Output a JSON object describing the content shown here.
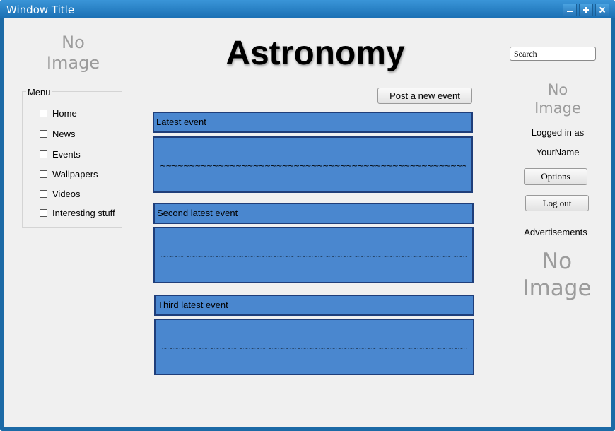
{
  "window": {
    "title": "Window Title"
  },
  "placeholders": {
    "top_left": {
      "line1": "No",
      "line2": "Image"
    },
    "user": {
      "line1": "No",
      "line2": "Image"
    },
    "ad": {
      "line1": "No",
      "line2": "Image"
    }
  },
  "header": {
    "title": "Astronomy"
  },
  "search": {
    "value": "Search"
  },
  "menu": {
    "legend": "Menu",
    "items": [
      {
        "label": "Home"
      },
      {
        "label": "News"
      },
      {
        "label": "Events"
      },
      {
        "label": "Wallpapers"
      },
      {
        "label": "Videos"
      },
      {
        "label": "Interesting stuff"
      }
    ]
  },
  "main": {
    "post_button": "Post a new event",
    "events": [
      {
        "title": "Latest event",
        "body": "~~~~~~~~~~~~~~~~~~~~~~~~~~~~~~~~~~~~~~~~~~~~~~~~~~~~~~~~~~~~~~~~~~~~~~~~~~~~~"
      },
      {
        "title": "Second latest event",
        "body": "~~~~~~~~~~~~~~~~~~~~~~~~~~~~~~~~~~~~~~~~~~~~~~~~~~~~~~~~~~~~~~~~~~~~~~~~~~~~~"
      },
      {
        "title": "Third latest event",
        "body": "~~~~~~~~~~~~~~~~~~~~~~~~~~~~~~~~~~~~~~~~~~~~~~~~~~~~~~~~~~~~~~~~~~~~~~~~~~~~~"
      }
    ]
  },
  "user": {
    "logged_in": "Logged in as",
    "name": "YourName",
    "options_button": "Options",
    "logout_button": "Log out"
  },
  "ads": {
    "label": "Advertisements"
  },
  "icons": {
    "minimize": "minimize-icon",
    "maximize": "maximize-icon",
    "close": "close-icon"
  },
  "colors": {
    "titlebar": "#1a6fb3",
    "event_fill": "#4a87cf",
    "event_border": "#1f3e7a",
    "placeholder_text": "#9c9c9c"
  }
}
